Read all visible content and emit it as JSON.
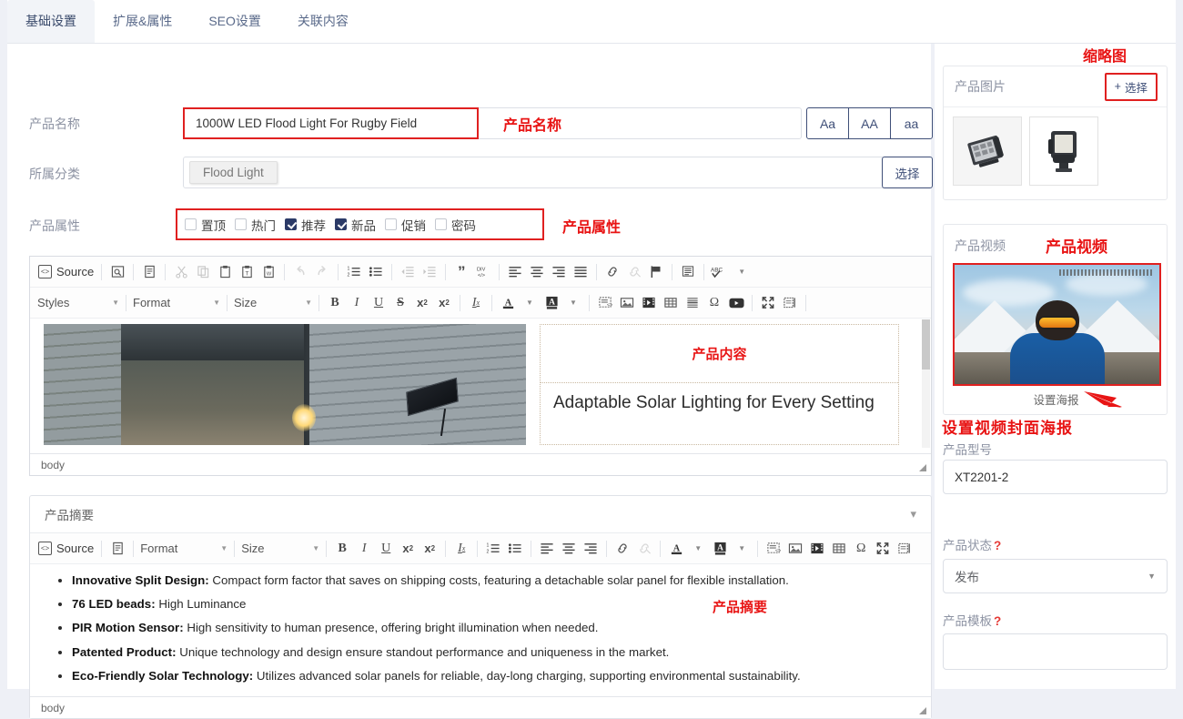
{
  "tabs": [
    {
      "label": "基础设置",
      "active": true
    },
    {
      "label": "扩展&属性",
      "active": false
    },
    {
      "label": "SEO设置",
      "active": false
    },
    {
      "label": "关联内容",
      "active": false
    }
  ],
  "form": {
    "name_label": "产品名称",
    "name_value": "1000W LED Flood Light For Rugby Field",
    "case_buttons": [
      "Aa",
      "AA",
      "aa"
    ],
    "category_label": "所属分类",
    "category_chip": "Flood Light",
    "category_select": "选择",
    "attrs_label": "产品属性",
    "attrs": [
      {
        "label": "置顶",
        "checked": false
      },
      {
        "label": "热门",
        "checked": false
      },
      {
        "label": "推荐",
        "checked": true
      },
      {
        "label": "新品",
        "checked": true
      },
      {
        "label": "促销",
        "checked": false
      },
      {
        "label": "密码",
        "checked": false
      }
    ]
  },
  "annotations": {
    "name": "产品名称",
    "attrs": "产品属性",
    "content": "产品内容",
    "summary": "产品摘要",
    "thumbnail": "缩略图",
    "video": "产品视频",
    "poster": "设置视频封面海报"
  },
  "editor_main": {
    "source_label": "Source",
    "styles_label": "Styles",
    "format_label": "Format",
    "size_label": "Size",
    "status": "body",
    "heading": "Adaptable Solar Lighting for Every Setting",
    "row1_icons": [
      "source-icon",
      "preview-icon",
      "templates-icon",
      "cut-icon",
      "copy-icon",
      "paste-icon",
      "paste-text-icon",
      "paste-word-icon",
      "undo-icon",
      "redo-icon",
      "numbered-list-icon",
      "bulleted-list-icon",
      "decrease-indent-icon",
      "increase-indent-icon",
      "blockquote-icon",
      "div-container-icon",
      "align-left-icon",
      "align-center-icon",
      "align-right-icon",
      "justify-icon",
      "link-icon",
      "unlink-icon",
      "anchor-icon",
      "text-justify-icon",
      "spellcheck-icon"
    ],
    "row2_icons": [
      "bold-icon",
      "italic-icon",
      "underline-icon",
      "strikethrough-icon",
      "subscript-icon",
      "superscript-icon",
      "remove-format-icon",
      "text-color-icon",
      "background-color-icon",
      "code-snippet-icon",
      "image-icon",
      "flash-icon",
      "table-icon",
      "horizontal-rule-icon",
      "special-char-icon",
      "youtube-icon",
      "maximize-icon",
      "show-blocks-icon"
    ]
  },
  "summary_panel": {
    "title": "产品摘要",
    "source_label": "Source",
    "format_label": "Format",
    "size_label": "Size",
    "status": "body",
    "items": [
      {
        "bold": "Innovative Split Design:",
        "rest": " Compact form factor that saves on shipping costs, featuring a detachable solar panel for flexible installation."
      },
      {
        "bold": "76 LED beads:",
        "rest": " High Luminance"
      },
      {
        "bold": "PIR Motion Sensor:",
        "rest": " High sensitivity to human presence, offering bright illumination when needed."
      },
      {
        "bold": "Patented Product:",
        "rest": " Unique technology and design ensure standout performance and uniqueness in the market."
      },
      {
        "bold": "Eco-Friendly Solar Technology:",
        "rest": " Utilizes advanced solar panels for reliable, day-long charging, supporting environmental sustainability."
      }
    ]
  },
  "sidebar": {
    "images_title": "产品图片",
    "pick_button": "选择",
    "video_title": "产品视频",
    "poster_link": "设置海报",
    "model_label": "产品型号",
    "model_value": "XT2201-2",
    "status_label": "产品状态",
    "status_value": "发布",
    "template_label": "产品模板",
    "template_value": ""
  },
  "colors": {
    "accent_red": "#e02020",
    "checkbox_navy": "#2b3a67",
    "button_border": "#3f4f78",
    "page_bg": "#eef0f6"
  }
}
